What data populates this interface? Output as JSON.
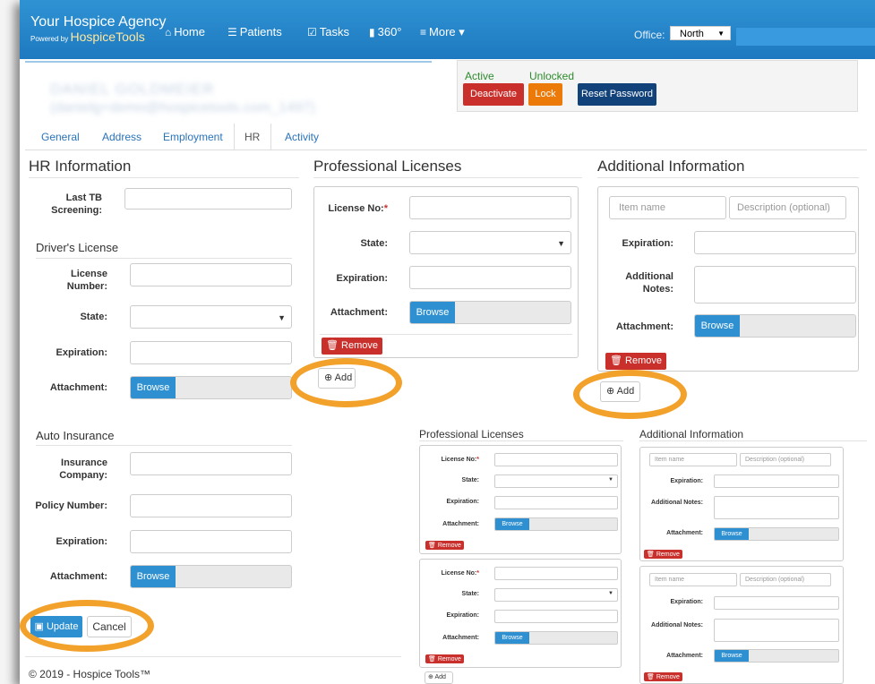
{
  "nav": {
    "brand_title": "Your Hospice Agency",
    "brand_powered": "Powered by",
    "brand_product": "HospiceTools",
    "items": [
      {
        "label": "Home",
        "icon": "home-icon",
        "glyph": "⌂"
      },
      {
        "label": "Patients",
        "icon": "list-icon",
        "glyph": "☰"
      },
      {
        "label": "Tasks",
        "icon": "check-square-icon",
        "glyph": "☑"
      },
      {
        "label": "360°",
        "icon": "bar-chart-icon",
        "glyph": "▮"
      },
      {
        "label": "More ▾",
        "icon": "menu-icon",
        "glyph": "≡"
      }
    ],
    "office_label": "Office:",
    "office_value": "North"
  },
  "user": {
    "status_active": "Active",
    "status_unlocked": "Unlocked",
    "deactivate_label": "Deactivate",
    "lock_label": "Lock",
    "reset_label": "Reset Password"
  },
  "tabs": [
    "General",
    "Address",
    "Employment",
    "HR",
    "Activity"
  ],
  "hr": {
    "title": "HR Information",
    "last_tb_label": "Last TB Screening:",
    "drivers_title": "Driver's License",
    "license_number_label": "License Number:",
    "state_label": "State:",
    "expiration_label": "Expiration:",
    "attachment_label": "Attachment:",
    "browse_label": "Browse",
    "auto_title": "Auto Insurance",
    "insurance_company_label": "Insurance Company:",
    "policy_number_label": "Policy Number:",
    "update_label": "Update",
    "cancel_label": "Cancel"
  },
  "licenses": {
    "title": "Professional Licenses",
    "license_no_label": "License No:",
    "required_mark": "*",
    "state_label": "State:",
    "expiration_label": "Expiration:",
    "attachment_label": "Attachment:",
    "browse_label": "Browse",
    "remove_label": "Remove",
    "add_label": "Add"
  },
  "additional": {
    "title": "Additional Information",
    "item_name_placeholder": "Item name",
    "description_placeholder": "Description (optional)",
    "expiration_label": "Expiration:",
    "notes_label": "Additional Notes:",
    "attachment_label": "Attachment:",
    "browse_label": "Browse",
    "remove_label": "Remove",
    "add_label": "Add"
  },
  "footer": {
    "copyright": "© 2019 - Hospice Tools™"
  },
  "colors": {
    "accent_ring": "#f2a12b",
    "nav_blue": "#1e79c0",
    "danger": "#c9302c",
    "primary": "#2e90d0"
  }
}
